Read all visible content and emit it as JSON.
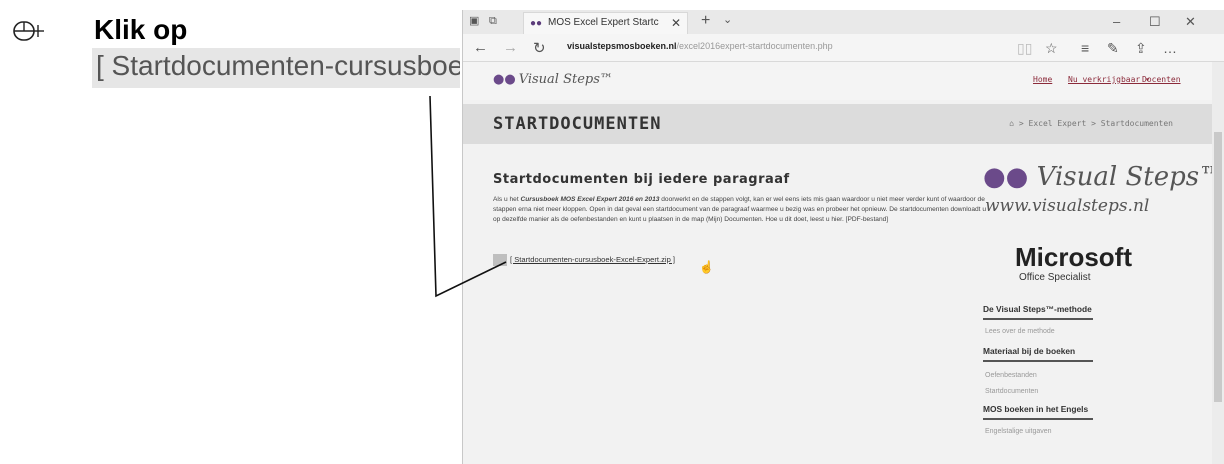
{
  "instruction": {
    "icon": "mouse-click-icon",
    "title": "Klik op",
    "zoom_text": "[ Startdocumenten-cursusboek-Excel-Expert.zip ]"
  },
  "browser": {
    "tab_title": "MOS Excel Expert Startc",
    "url_domain": "visualstepsmosboeken.nl",
    "url_path": "/excel2016expert-startdocumenten.php"
  },
  "site": {
    "logo_text": "Visual Steps™",
    "nav": [
      "Home",
      "Nu verkrijgbaar ▾",
      "Docenten"
    ],
    "banner_title": "STARTDOCUMENTEN",
    "breadcrumb": "⌂ > Excel Expert > Startdocumenten"
  },
  "article": {
    "heading": "Startdocumenten bij iedere paragraaf",
    "body_intro": "Als u het ",
    "body_book": "Cursusboek MOS Excel Expert 2016 en 2013",
    "body_rest": " doorwerkt en de stappen volgt, kan er wel eens iets mis gaan waardoor u niet meer verder kunt of waardoor de stappen erna niet meer kloppen. Open in dat geval een startdocument van de paragraaf waarmee u bezig was en probeer het opnieuw. De startdocumenten downloadt u op dezelfde manier als de oefenbestanden en kunt u plaatsen in de map (Mijn) Documenten. Hoe u dit doet, leest u hier. [PDF-bestand]",
    "download_link": "[ Startdocumenten-cursusboek-Excel-Expert.zip ]"
  },
  "sidebar": {
    "brand": "Visual Steps™",
    "brand_url": "www.visualsteps.nl",
    "ms_title": "Microsoft",
    "ms_sub": "Office Specialist",
    "sections": [
      {
        "heading": "De Visual Steps™-methode",
        "items": [
          "Lees over de methode"
        ]
      },
      {
        "heading": "Materiaal bij de boeken",
        "items": [
          "Oefenbestanden",
          "Startdocumenten"
        ]
      },
      {
        "heading": "MOS boeken in het Engels",
        "items": [
          "Engelstalige uitgaven"
        ]
      }
    ]
  }
}
